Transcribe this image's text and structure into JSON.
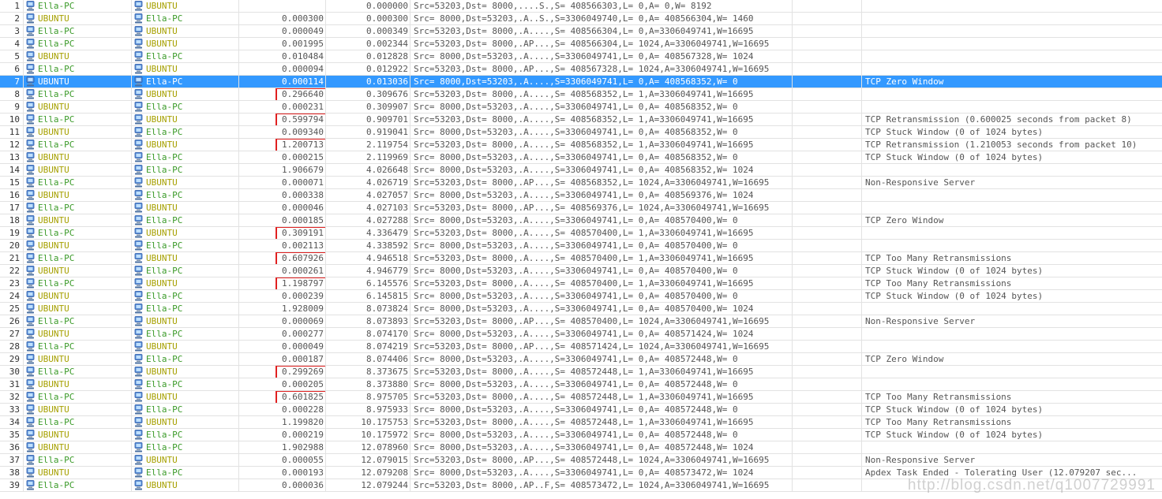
{
  "colors": {
    "selected_row": "#3399ff",
    "ella_pc": "#3a9a28",
    "ubuntu": "#a6a000",
    "highlight_box": "#e02020"
  },
  "icons": {
    "host": "computer-host-icon"
  },
  "watermark": "http://blog.csdn.net/q1007729991",
  "rows": [
    {
      "num": "1",
      "src": "Ella-PC",
      "dst": "UBUNTU",
      "delta": "",
      "time": "0.000000",
      "summary": "Src=53203,Dst= 8000,....S.,S= 408566303,L=     0,A=          0,W= 8192",
      "diag": ""
    },
    {
      "num": "2",
      "src": "UBUNTU",
      "dst": "Ella-PC",
      "delta": "0.000300",
      "time": "0.000300",
      "summary": "Src= 8000,Dst=53203,.A..S.,S=3306049740,L=     0,A= 408566304,W= 1460",
      "diag": ""
    },
    {
      "num": "3",
      "src": "Ella-PC",
      "dst": "UBUNTU",
      "delta": "0.000049",
      "time": "0.000349",
      "summary": "Src=53203,Dst= 8000,.A....,S= 408566304,L=     0,A=3306049741,W=16695",
      "diag": ""
    },
    {
      "num": "4",
      "src": "Ella-PC",
      "dst": "UBUNTU",
      "delta": "0.001995",
      "time": "0.002344",
      "summary": "Src=53203,Dst= 8000,.AP...,S= 408566304,L= 1024,A=3306049741,W=16695",
      "diag": ""
    },
    {
      "num": "5",
      "src": "UBUNTU",
      "dst": "Ella-PC",
      "delta": "0.010484",
      "time": "0.012828",
      "summary": "Src= 8000,Dst=53203,.A....,S=3306049741,L=     0,A= 408567328,W= 1024",
      "diag": ""
    },
    {
      "num": "6",
      "src": "Ella-PC",
      "dst": "UBUNTU",
      "delta": "0.000094",
      "time": "0.012922",
      "summary": "Src=53203,Dst= 8000,.AP...,S= 408567328,L= 1024,A=3306049741,W=16695",
      "diag": ""
    },
    {
      "num": "7",
      "src": "UBUNTU",
      "dst": "Ella-PC",
      "delta": "0.000114",
      "time": "0.013036",
      "summary": "Src= 8000,Dst=53203,.A....,S=3306049741,L=     0,A= 408568352,W=    0",
      "diag": "TCP Zero Window",
      "selected": true
    },
    {
      "num": "8",
      "src": "Ella-PC",
      "dst": "UBUNTU",
      "delta": "0.296640",
      "time": "0.309676",
      "summary": "Src=53203,Dst= 8000,.A....,S= 408568352,L=     1,A=3306049741,W=16695",
      "diag": "",
      "boxed": true
    },
    {
      "num": "9",
      "src": "UBUNTU",
      "dst": "Ella-PC",
      "delta": "0.000231",
      "time": "0.309907",
      "summary": "Src= 8000,Dst=53203,.A....,S=3306049741,L=     0,A= 408568352,W=    0",
      "diag": ""
    },
    {
      "num": "10",
      "src": "Ella-PC",
      "dst": "UBUNTU",
      "delta": "0.599794",
      "time": "0.909701",
      "summary": "Src=53203,Dst= 8000,.A....,S= 408568352,L=     1,A=3306049741,W=16695",
      "diag": "TCP Retransmission (0.600025 seconds from packet 8)",
      "boxed": true
    },
    {
      "num": "11",
      "src": "UBUNTU",
      "dst": "Ella-PC",
      "delta": "0.009340",
      "time": "0.919041",
      "summary": "Src= 8000,Dst=53203,.A....,S=3306049741,L=     0,A= 408568352,W=    0",
      "diag": "TCP Stuck Window (0 of 1024 bytes)"
    },
    {
      "num": "12",
      "src": "Ella-PC",
      "dst": "UBUNTU",
      "delta": "1.200713",
      "time": "2.119754",
      "summary": "Src=53203,Dst= 8000,.A....,S= 408568352,L=     1,A=3306049741,W=16695",
      "diag": "TCP Retransmission (1.210053 seconds from packet 10)",
      "boxed": true
    },
    {
      "num": "13",
      "src": "UBUNTU",
      "dst": "Ella-PC",
      "delta": "0.000215",
      "time": "2.119969",
      "summary": "Src= 8000,Dst=53203,.A....,S=3306049741,L=     0,A= 408568352,W=    0",
      "diag": "TCP Stuck Window (0 of 1024 bytes)"
    },
    {
      "num": "14",
      "src": "UBUNTU",
      "dst": "Ella-PC",
      "delta": "1.906679",
      "time": "4.026648",
      "summary": "Src= 8000,Dst=53203,.A....,S=3306049741,L=     0,A= 408568352,W= 1024",
      "diag": ""
    },
    {
      "num": "15",
      "src": "Ella-PC",
      "dst": "UBUNTU",
      "delta": "0.000071",
      "time": "4.026719",
      "summary": "Src=53203,Dst= 8000,.AP...,S= 408568352,L= 1024,A=3306049741,W=16695",
      "diag": "Non-Responsive Server"
    },
    {
      "num": "16",
      "src": "UBUNTU",
      "dst": "Ella-PC",
      "delta": "0.000338",
      "time": "4.027057",
      "summary": "Src= 8000,Dst=53203,.A....,S=3306049741,L=     0,A= 408569376,W= 1024",
      "diag": ""
    },
    {
      "num": "17",
      "src": "Ella-PC",
      "dst": "UBUNTU",
      "delta": "0.000046",
      "time": "4.027103",
      "summary": "Src=53203,Dst= 8000,.AP...,S= 408569376,L= 1024,A=3306049741,W=16695",
      "diag": ""
    },
    {
      "num": "18",
      "src": "UBUNTU",
      "dst": "Ella-PC",
      "delta": "0.000185",
      "time": "4.027288",
      "summary": "Src= 8000,Dst=53203,.A....,S=3306049741,L=     0,A= 408570400,W=    0",
      "diag": "TCP Zero Window"
    },
    {
      "num": "19",
      "src": "Ella-PC",
      "dst": "UBUNTU",
      "delta": "0.309191",
      "time": "4.336479",
      "summary": "Src=53203,Dst= 8000,.A....,S= 408570400,L=     1,A=3306049741,W=16695",
      "diag": "",
      "boxed": true
    },
    {
      "num": "20",
      "src": "UBUNTU",
      "dst": "Ella-PC",
      "delta": "0.002113",
      "time": "4.338592",
      "summary": "Src= 8000,Dst=53203,.A....,S=3306049741,L=     0,A= 408570400,W=    0",
      "diag": ""
    },
    {
      "num": "21",
      "src": "Ella-PC",
      "dst": "UBUNTU",
      "delta": "0.607926",
      "time": "4.946518",
      "summary": "Src=53203,Dst= 8000,.A....,S= 408570400,L=     1,A=3306049741,W=16695",
      "diag": "TCP Too Many Retransmissions",
      "boxed": true
    },
    {
      "num": "22",
      "src": "UBUNTU",
      "dst": "Ella-PC",
      "delta": "0.000261",
      "time": "4.946779",
      "summary": "Src= 8000,Dst=53203,.A....,S=3306049741,L=     0,A= 408570400,W=    0",
      "diag": "TCP Stuck Window (0 of 1024 bytes)"
    },
    {
      "num": "23",
      "src": "Ella-PC",
      "dst": "UBUNTU",
      "delta": "1.198797",
      "time": "6.145576",
      "summary": "Src=53203,Dst= 8000,.A....,S= 408570400,L=     1,A=3306049741,W=16695",
      "diag": "TCP Too Many Retransmissions",
      "boxed": true
    },
    {
      "num": "24",
      "src": "UBUNTU",
      "dst": "Ella-PC",
      "delta": "0.000239",
      "time": "6.145815",
      "summary": "Src= 8000,Dst=53203,.A....,S=3306049741,L=     0,A= 408570400,W=    0",
      "diag": "TCP Stuck Window (0 of 1024 bytes)"
    },
    {
      "num": "25",
      "src": "UBUNTU",
      "dst": "Ella-PC",
      "delta": "1.928009",
      "time": "8.073824",
      "summary": "Src= 8000,Dst=53203,.A....,S=3306049741,L=     0,A= 408570400,W= 1024",
      "diag": ""
    },
    {
      "num": "26",
      "src": "Ella-PC",
      "dst": "UBUNTU",
      "delta": "0.000069",
      "time": "8.073893",
      "summary": "Src=53203,Dst= 8000,.AP...,S= 408570400,L= 1024,A=3306049741,W=16695",
      "diag": "Non-Responsive Server"
    },
    {
      "num": "27",
      "src": "UBUNTU",
      "dst": "Ella-PC",
      "delta": "0.000277",
      "time": "8.074170",
      "summary": "Src= 8000,Dst=53203,.A....,S=3306049741,L=     0,A= 408571424,W= 1024",
      "diag": ""
    },
    {
      "num": "28",
      "src": "Ella-PC",
      "dst": "UBUNTU",
      "delta": "0.000049",
      "time": "8.074219",
      "summary": "Src=53203,Dst= 8000,.AP...,S= 408571424,L= 1024,A=3306049741,W=16695",
      "diag": ""
    },
    {
      "num": "29",
      "src": "UBUNTU",
      "dst": "Ella-PC",
      "delta": "0.000187",
      "time": "8.074406",
      "summary": "Src= 8000,Dst=53203,.A....,S=3306049741,L=     0,A= 408572448,W=    0",
      "diag": "TCP Zero Window"
    },
    {
      "num": "30",
      "src": "Ella-PC",
      "dst": "UBUNTU",
      "delta": "0.299269",
      "time": "8.373675",
      "summary": "Src=53203,Dst= 8000,.A....,S= 408572448,L=     1,A=3306049741,W=16695",
      "diag": "",
      "boxed": true
    },
    {
      "num": "31",
      "src": "UBUNTU",
      "dst": "Ella-PC",
      "delta": "0.000205",
      "time": "8.373880",
      "summary": "Src= 8000,Dst=53203,.A....,S=3306049741,L=     0,A= 408572448,W=    0",
      "diag": ""
    },
    {
      "num": "32",
      "src": "Ella-PC",
      "dst": "UBUNTU",
      "delta": "0.601825",
      "time": "8.975705",
      "summary": "Src=53203,Dst= 8000,.A....,S= 408572448,L=     1,A=3306049741,W=16695",
      "diag": "TCP Too Many Retransmissions",
      "boxed": true
    },
    {
      "num": "33",
      "src": "UBUNTU",
      "dst": "Ella-PC",
      "delta": "0.000228",
      "time": "8.975933",
      "summary": "Src= 8000,Dst=53203,.A....,S=3306049741,L=     0,A= 408572448,W=    0",
      "diag": "TCP Stuck Window (0 of 1024 bytes)"
    },
    {
      "num": "34",
      "src": "Ella-PC",
      "dst": "UBUNTU",
      "delta": "1.199820",
      "time": "10.175753",
      "summary": "Src=53203,Dst= 8000,.A....,S= 408572448,L=     1,A=3306049741,W=16695",
      "diag": "TCP Too Many Retransmissions"
    },
    {
      "num": "35",
      "src": "UBUNTU",
      "dst": "Ella-PC",
      "delta": "0.000219",
      "time": "10.175972",
      "summary": "Src= 8000,Dst=53203,.A....,S=3306049741,L=     0,A= 408572448,W=    0",
      "diag": "TCP Stuck Window (0 of 1024 bytes)"
    },
    {
      "num": "36",
      "src": "UBUNTU",
      "dst": "Ella-PC",
      "delta": "1.902988",
      "time": "12.078960",
      "summary": "Src= 8000,Dst=53203,.A....,S=3306049741,L=     0,A= 408572448,W= 1024",
      "diag": ""
    },
    {
      "num": "37",
      "src": "Ella-PC",
      "dst": "UBUNTU",
      "delta": "0.000055",
      "time": "12.079015",
      "summary": "Src=53203,Dst= 8000,.AP...,S= 408572448,L= 1024,A=3306049741,W=16695",
      "diag": "Non-Responsive Server"
    },
    {
      "num": "38",
      "src": "UBUNTU",
      "dst": "Ella-PC",
      "delta": "0.000193",
      "time": "12.079208",
      "summary": "Src= 8000,Dst=53203,.A....,S=3306049741,L=     0,A= 408573472,W= 1024",
      "diag": "Apdex Task Ended - Tolerating User (12.079207 sec..."
    },
    {
      "num": "39",
      "src": "Ella-PC",
      "dst": "UBUNTU",
      "delta": "0.000036",
      "time": "12.079244",
      "summary": "Src=53203,Dst= 8000,.AP..F,S= 408573472,L= 1024,A=3306049741,W=16695",
      "diag": ""
    }
  ]
}
